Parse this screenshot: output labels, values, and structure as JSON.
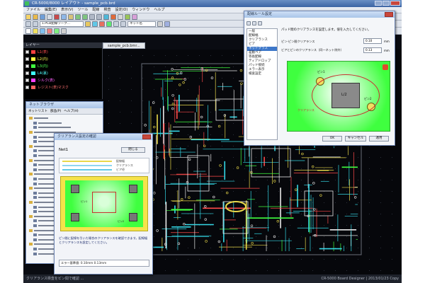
{
  "app": {
    "title": "CR-5000/8000 レイアウト - sample_pcb.brd",
    "menu": [
      "ファイル",
      "編集(E)",
      "表示(V)",
      "ツール",
      "配線",
      "検査",
      "設定(O)",
      "ウィンドウ",
      "ヘルプ"
    ],
    "toolbar_select": "1.PCB配線ワーク...",
    "toolbar_select2": "ネット名",
    "document_tab": "sample_pcb.bmr...",
    "status_left": "クリアランス検査をピン間で確認 ...",
    "status_right": "CR-5000 Board Designer  | 2013/01/23 Copy"
  },
  "layers_panel": {
    "title": "レイヤー",
    "items": [
      {
        "label": "L1(表)",
        "color": "#ff4040"
      },
      {
        "label": "L2(内)",
        "color": "#ffff40"
      },
      {
        "label": "L3(内)",
        "color": "#40ff40"
      },
      {
        "label": "L4(裏)",
        "color": "#40ffff"
      },
      {
        "label": "シルク(表)",
        "color": "#ff40ff"
      },
      {
        "label": "レジスト(表)マスク",
        "color": "#ff6060"
      }
    ]
  },
  "tree_window": {
    "title": "ネットブラウザ",
    "tabs": [
      "ネットリスト",
      "部品(P)",
      "ヘルプ(H)"
    ]
  },
  "clearance_dialog": {
    "title": "クリアランス設定の確認",
    "label": "Net1",
    "button": "閉じる",
    "legend": [
      "配線幅",
      "クリアランス",
      "ビア径"
    ],
    "message": "ピン間に配線を引いた場合のクリアランスを確認できます。配線幅とクリアランスを設定してください。",
    "footer": "エラー基準値: 0.10mm 0.13mm",
    "pad_labels": [
      "ピン1",
      "ピン2"
    ]
  },
  "settings_dialog": {
    "title": "配線ルール設定",
    "tree": [
      "一般",
      "配線幅",
      "クリアランス",
      "ビア",
      "ネットクラス",
      "差動ペア",
      "等長配線",
      "ティアドロップ",
      "パッド接続",
      "エラー表示",
      "検査設定"
    ],
    "selected_index": 4,
    "prompt": "パッド間のクリアランスを設定します。値を入力してください。",
    "field1_label": "ピン-ピン間クリアランス",
    "field1_value": "0.10",
    "field1_unit": "mm",
    "field2_label": "ビアとピンのクリアランス（同一ネット除外）",
    "field2_value": "0.13",
    "field2_unit": "mm",
    "diagram_labels": {
      "pad_a": "ピン1",
      "pad_b": "ピン2",
      "center": "L/2",
      "note": "クリアランス"
    },
    "buttons": [
      "OK",
      "キャンセル",
      "適用"
    ]
  },
  "colors": {
    "board_accent": "#40ff40",
    "trace_cyan": "#34d8e6",
    "trace_yellow": "#e8d84a",
    "dialog_green": "#3fff3f"
  }
}
